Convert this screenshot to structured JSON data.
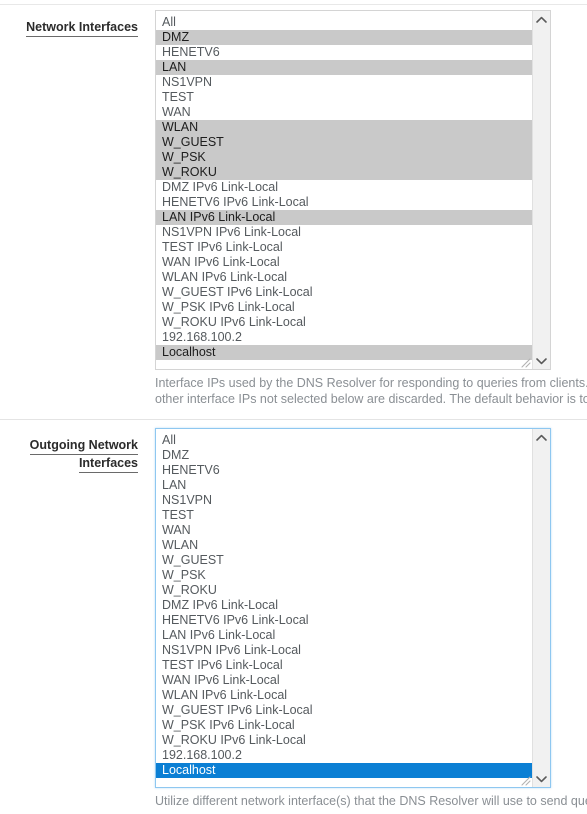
{
  "interfaceOptions": [
    "All",
    "DMZ",
    "HENETV6",
    "LAN",
    "NS1VPN",
    "TEST",
    "WAN",
    "WLAN",
    "W_GUEST",
    "W_PSK",
    "W_ROKU",
    "DMZ IPv6 Link-Local",
    "HENETV6 IPv6 Link-Local",
    "LAN IPv6 Link-Local",
    "NS1VPN IPv6 Link-Local",
    "TEST IPv6 Link-Local",
    "WAN IPv6 Link-Local",
    "WLAN IPv6 Link-Local",
    "W_GUEST IPv6 Link-Local",
    "W_PSK IPv6 Link-Local",
    "W_ROKU IPv6 Link-Local",
    "192.168.100.2",
    "Localhost"
  ],
  "network_interfaces": {
    "label_lines": [
      "Network Interfaces"
    ],
    "selected": [
      "DMZ",
      "LAN",
      "WLAN",
      "W_GUEST",
      "W_PSK",
      "W_ROKU",
      "LAN IPv6 Link-Local",
      "Localhost"
    ],
    "selection_style": "gray",
    "focused": false,
    "help_lines": [
      "Interface IPs used by the DNS Resolver for responding to queries from clients.",
      "other interface IPs not selected below are discarded. The default behavior is to"
    ]
  },
  "outgoing_network_interfaces": {
    "label_lines": [
      "Outgoing Network",
      "Interfaces"
    ],
    "selected": [
      "Localhost"
    ],
    "selection_style": "blue",
    "focused": true,
    "help_lines": [
      "Utilize different network interface(s) that the DNS Resolver will use to send que"
    ]
  },
  "icons": {
    "scroll_up": "chevron-up-icon",
    "scroll_down": "chevron-down-icon",
    "resize": "resize-grip-icon"
  },
  "colors": {
    "selection_gray": "#c9c9c9",
    "selection_blue": "#0b7fd4",
    "focus_border": "#8ec7f0",
    "border": "#d4d4d4",
    "help_text": "#8a8f94",
    "option_text": "#555a5e"
  }
}
